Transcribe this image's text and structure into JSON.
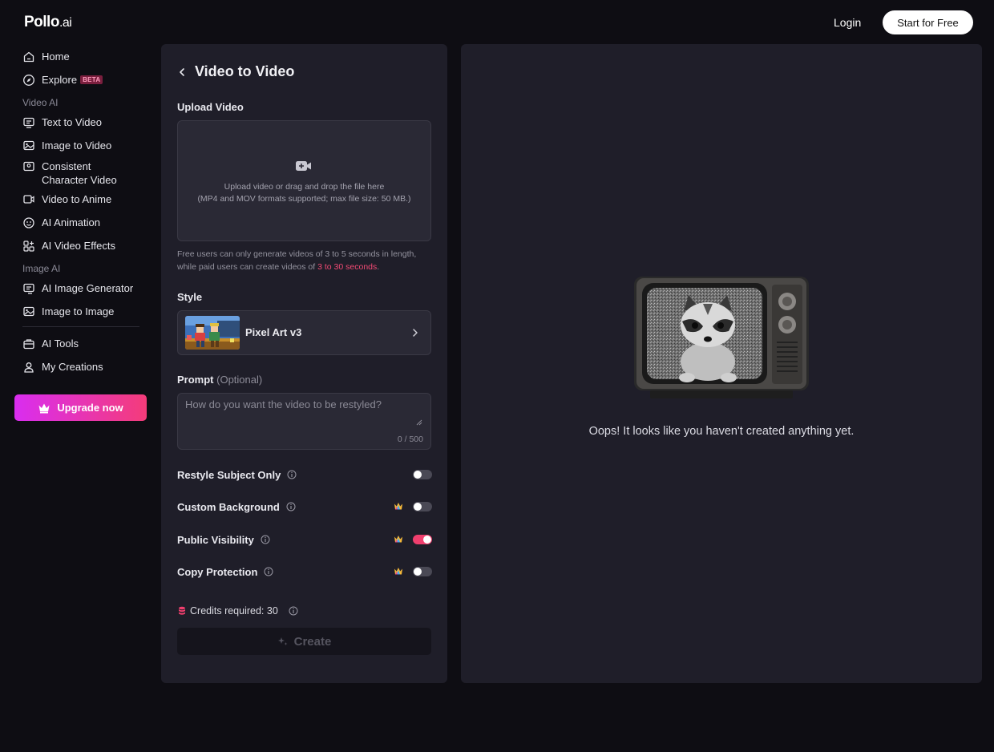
{
  "header": {
    "logo_main": "Pollo",
    "logo_suffix": ".ai",
    "login": "Login",
    "start_free": "Start for Free"
  },
  "sidebar": {
    "home": "Home",
    "explore": "Explore",
    "explore_badge": "BETA",
    "section_video": "Video AI",
    "text_to_video": "Text to Video",
    "image_to_video": "Image to Video",
    "consistent_line1": "Consistent",
    "consistent_line2": "Character Video",
    "video_to_anime": "Video to Anime",
    "ai_animation": "AI Animation",
    "ai_video_effects": "AI Video Effects",
    "section_image": "Image AI",
    "ai_image_generator": "AI Image Generator",
    "image_to_image": "Image to Image",
    "ai_tools": "AI Tools",
    "my_creations": "My Creations",
    "upgrade": "Upgrade now"
  },
  "form": {
    "title": "Video to Video",
    "upload_label": "Upload Video",
    "upload_text": "Upload video or drag and drop the file here",
    "upload_formats": "(MP4 and MOV formats supported; max file size: 50 MB.)",
    "note_prefix": "Free users can only generate videos of 3 to 5 seconds in length, while paid users can create videos of ",
    "note_highlight": "3 to 30 seconds",
    "note_suffix": ".",
    "style_label": "Style",
    "style_name": "Pixel Art v3",
    "prompt_label": "Prompt",
    "prompt_optional": "(Optional)",
    "prompt_placeholder": "How do you want the video to be restyled?",
    "prompt_value": "",
    "prompt_count": "0 / 500",
    "toggles": [
      {
        "label": "Restyle Subject Only",
        "on": false,
        "premium": false
      },
      {
        "label": "Custom Background",
        "on": false,
        "premium": true
      },
      {
        "label": "Public Visibility",
        "on": true,
        "premium": true
      },
      {
        "label": "Copy Protection",
        "on": false,
        "premium": true
      }
    ],
    "credits": "Credits required: 30",
    "create": "Create"
  },
  "preview": {
    "empty_message": "Oops! It looks like you haven't created anything yet."
  },
  "colors": {
    "accent": "#f03f6e",
    "upgrade_start": "#d92df0",
    "upgrade_end": "#f43c7a",
    "panel": "#1f1e29",
    "background": "#0e0d13"
  }
}
